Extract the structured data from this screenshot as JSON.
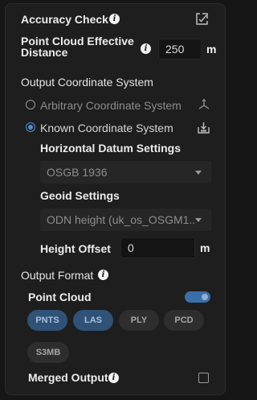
{
  "accuracy_check": {
    "label": "Accuracy Check"
  },
  "effective_distance": {
    "label_line1": "Point Cloud Effective",
    "label_line2": "Distance",
    "value": "250",
    "unit": "m"
  },
  "output_coordinate": {
    "heading": "Output Coordinate System",
    "arbitrary_label": "Arbitrary Coordinate System",
    "known_label": "Known Coordinate System",
    "selected": "known",
    "horizontal_datum": {
      "label": "Horizontal Datum Settings",
      "value": "OSGB 1936"
    },
    "geoid": {
      "label": "Geoid Settings",
      "value": "ODN height (uk_os_OSGM1..."
    },
    "height_offset": {
      "label": "Height Offset",
      "value": "0",
      "unit": "m"
    }
  },
  "output_format": {
    "heading": "Output Format",
    "point_cloud_label": "Point Cloud",
    "point_cloud_enabled": true,
    "formats": [
      {
        "label": "PNTS",
        "selected": true
      },
      {
        "label": "LAS",
        "selected": true
      },
      {
        "label": "PLY",
        "selected": false
      },
      {
        "label": "PCD",
        "selected": false
      },
      {
        "label": "S3MB",
        "selected": false
      }
    ],
    "merged_output_label": "Merged Output",
    "merged_output_checked": false
  },
  "colors": {
    "accent": "#4d8fd9",
    "chip_selected": "#2f5276",
    "panel": "#1e1e1e"
  }
}
